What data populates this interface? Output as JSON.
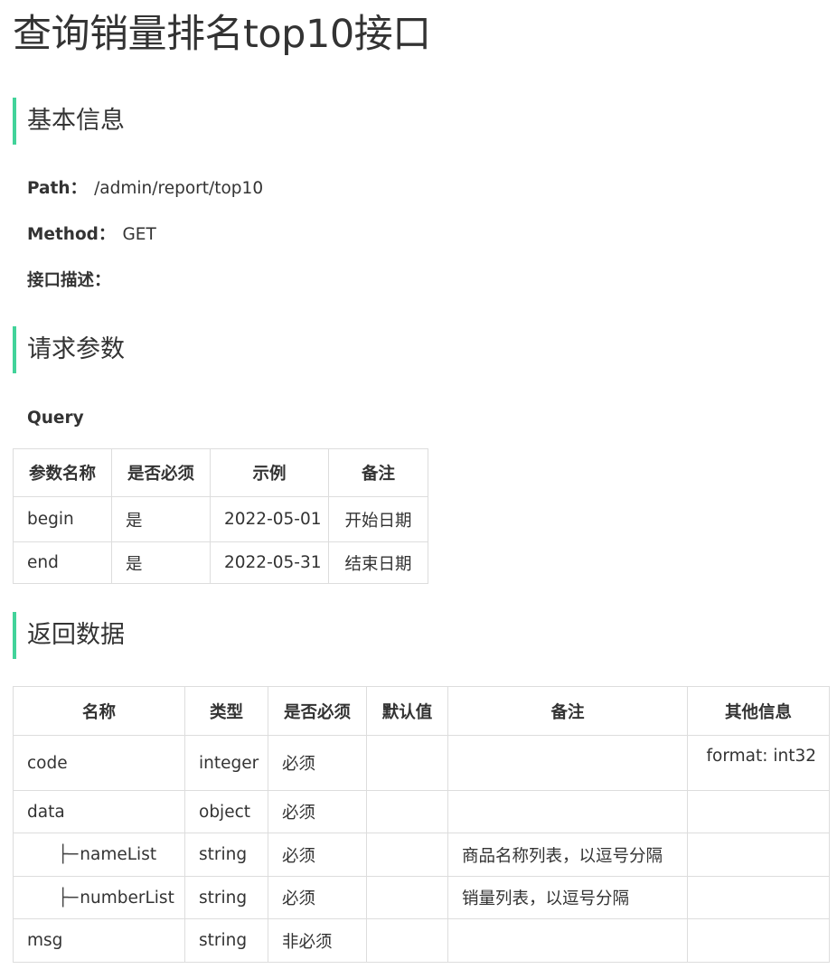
{
  "title": "查询销量排名top10接口",
  "sections": {
    "basic": "基本信息",
    "request": "请求参数",
    "response": "返回数据"
  },
  "basic_info": {
    "path_label": "Path：",
    "path_value": "/admin/report/top10",
    "method_label": "Method：",
    "method_value": "GET",
    "desc_label": "接口描述："
  },
  "query": {
    "label": "Query",
    "headers": [
      "参数名称",
      "是否必须",
      "示例",
      "备注"
    ],
    "rows": [
      [
        "begin",
        "是",
        "2022-05-01",
        "开始日期"
      ],
      [
        "end",
        "是",
        "2022-05-31",
        "结束日期"
      ]
    ]
  },
  "response": {
    "headers": [
      "名称",
      "类型",
      "是否必须",
      "默认值",
      "备注",
      "其他信息"
    ],
    "tree_prefix": "├─",
    "rows": [
      [
        "code",
        "integer",
        "必须",
        "",
        "",
        "format: int32"
      ],
      [
        "data",
        "object",
        "必须",
        "",
        "",
        ""
      ],
      [
        "nameList",
        "string",
        "必须",
        "",
        "商品名称列表，以逗号分隔",
        ""
      ],
      [
        "numberList",
        "string",
        "必须",
        "",
        "销量列表，以逗号分隔",
        ""
      ],
      [
        "msg",
        "string",
        "非必须",
        "",
        "",
        ""
      ]
    ]
  }
}
